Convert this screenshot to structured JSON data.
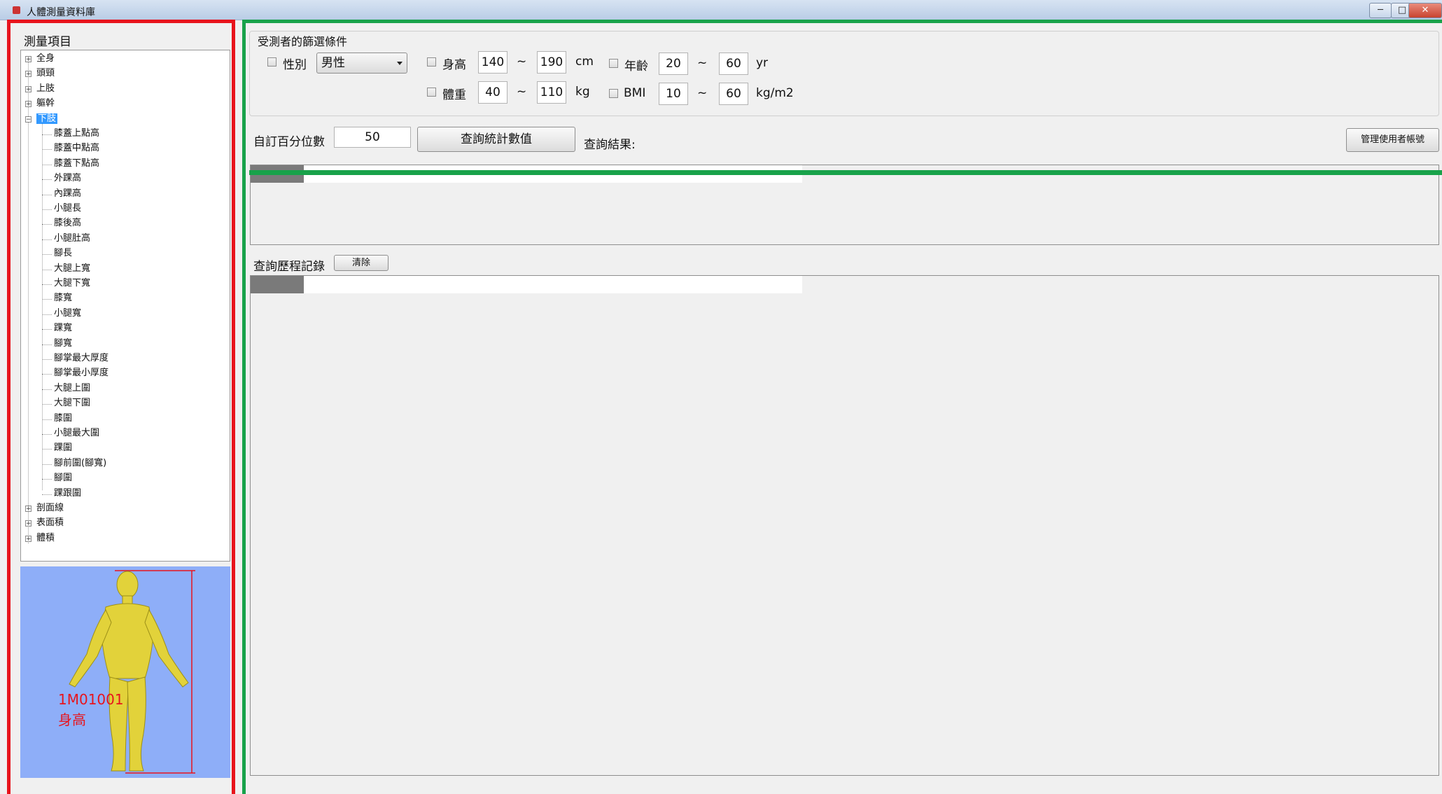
{
  "window": {
    "title": "人體測量資料庫",
    "controls": {
      "minimize": "─",
      "maximize": "□",
      "close": "✕"
    }
  },
  "sidebar": {
    "title": "測量項目",
    "tree": {
      "top_before": [
        "全身",
        "頭頸",
        "上肢",
        "軀幹"
      ],
      "expanded": "下肢",
      "children": [
        "膝蓋上點高",
        "膝蓋中點高",
        "膝蓋下點高",
        "外踝高",
        "內踝高",
        "小腿長",
        "膝後高",
        "小腿肚高",
        "腳長",
        "大腿上寬",
        "大腿下寬",
        "膝寬",
        "小腿寬",
        "踝寬",
        "腳寬",
        "腳掌最大厚度",
        "腳掌最小厚度",
        "大腿上圍",
        "大腿下圍",
        "膝圍",
        "小腿最大圍",
        "踝圍",
        "腳前圍(腳寬)",
        "腳圍",
        "踝跟圍"
      ],
      "top_after": [
        "剖面線",
        "表面積",
        "體積"
      ]
    },
    "figure": {
      "code": "1M01001",
      "name": "身高"
    }
  },
  "filters": {
    "title": "受測者的篩選條件",
    "gender": {
      "label": "性別",
      "value": "男性"
    },
    "height": {
      "label": "身高",
      "min": "140",
      "tilde": "~",
      "max": "190",
      "unit": "cm"
    },
    "age": {
      "label": "年齡",
      "min": "20",
      "tilde": "~",
      "max": "60",
      "unit": "yr"
    },
    "weight": {
      "label": "體重",
      "min": "40",
      "tilde": "~",
      "max": "110",
      "unit": "kg"
    },
    "bmi": {
      "label": "BMI",
      "min": "10",
      "tilde": "~",
      "max": "60",
      "unit": "kg/m2"
    }
  },
  "query": {
    "percentile_label": "自訂百分位數",
    "percentile_value": "50",
    "query_button": "查詢統計數值",
    "result_label": "查詢結果:",
    "manage_button": "管理使用者帳號"
  },
  "history": {
    "label": "查詢歷程記錄",
    "clear_button": "清除"
  }
}
